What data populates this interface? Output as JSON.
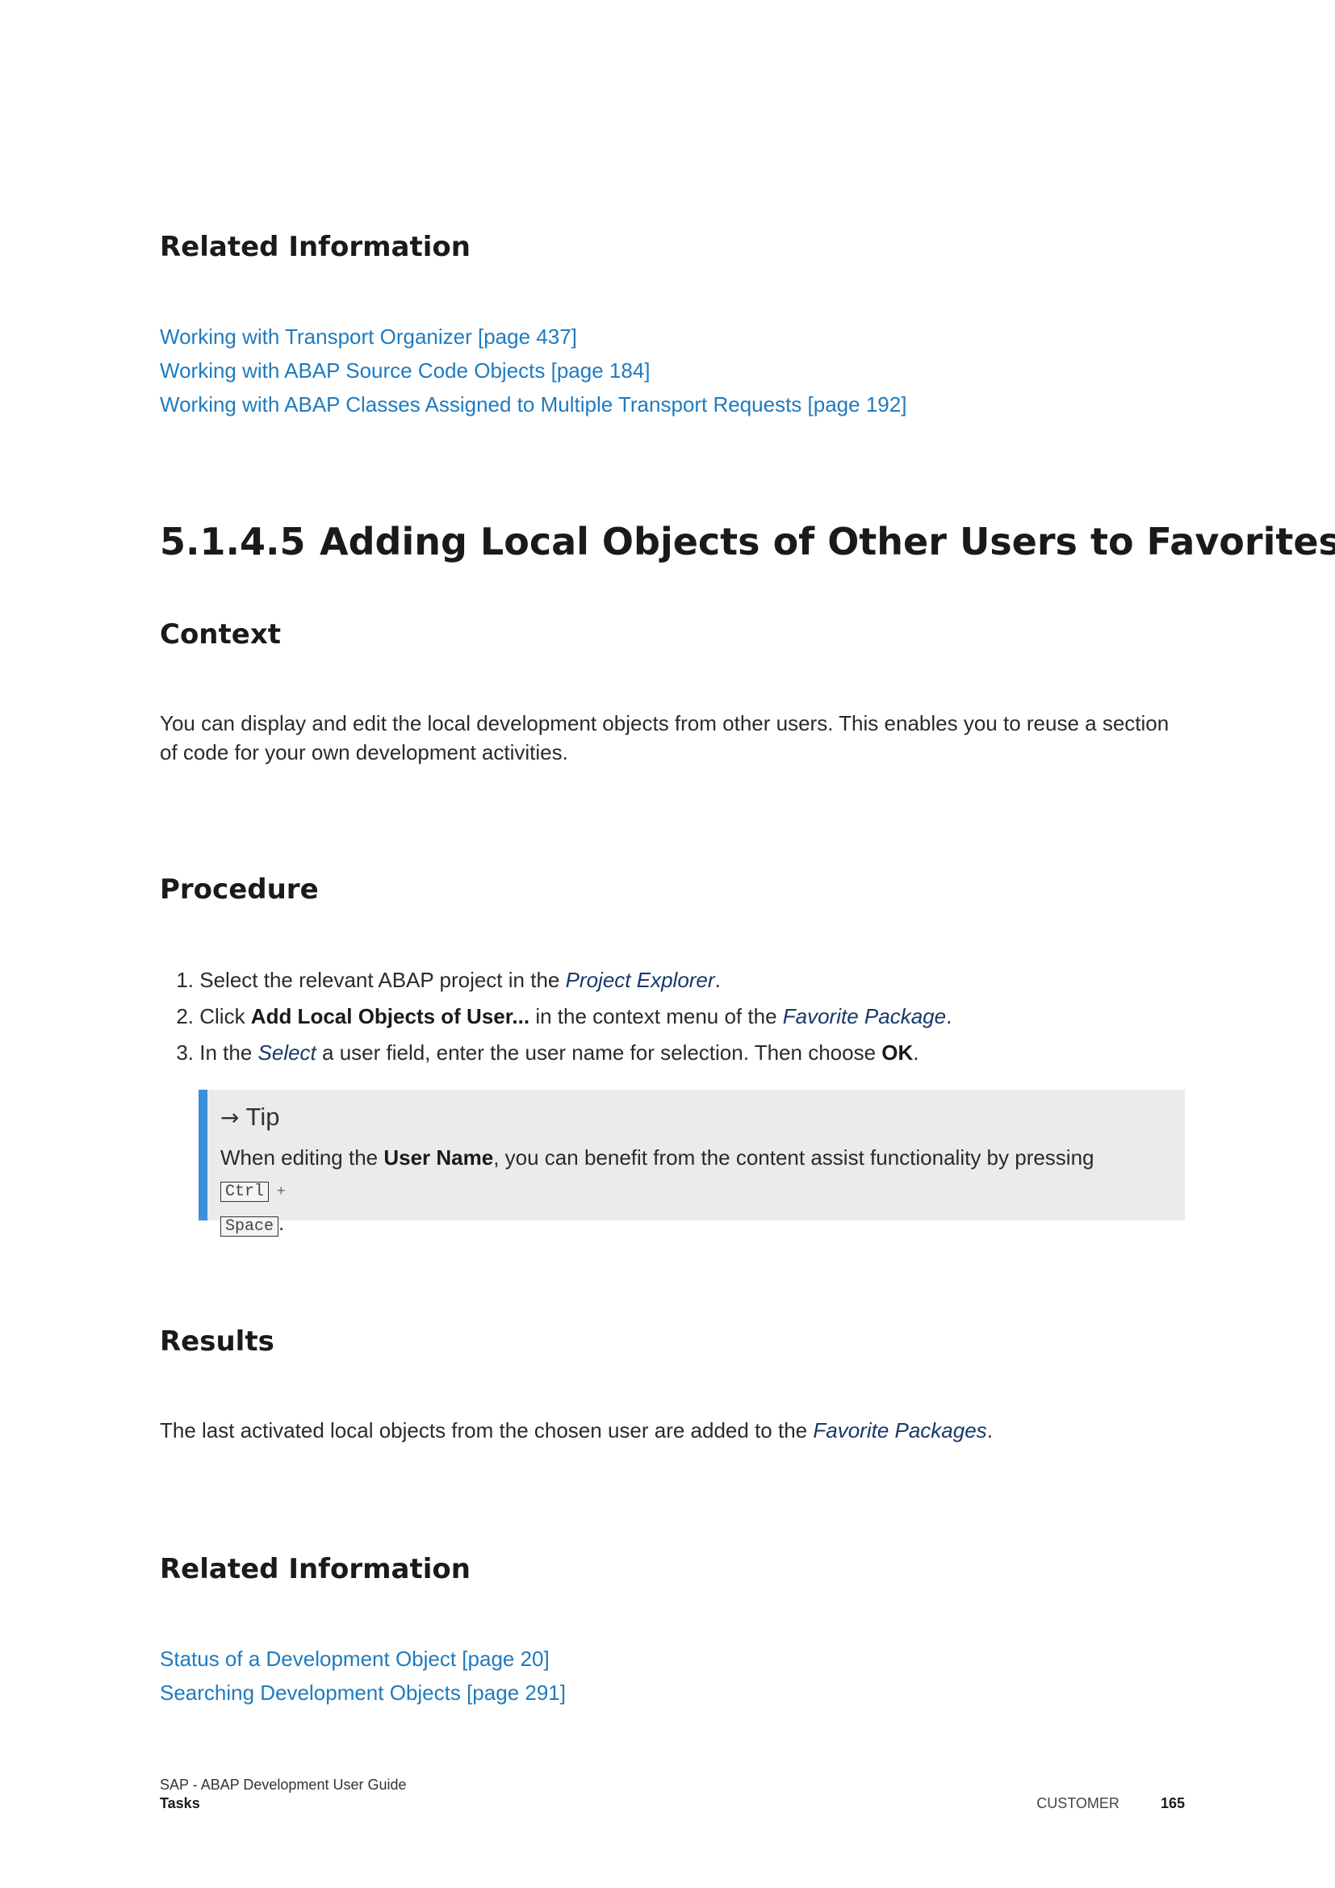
{
  "related1": {
    "heading": "Related Information",
    "links": [
      "Working with Transport Organizer [page 437]",
      "Working with ABAP Source Code Objects [page 184]",
      "Working with ABAP Classes Assigned to Multiple Transport Requests [page 192]"
    ]
  },
  "section": {
    "number": "5.1.4.5",
    "title": "Adding Local Objects of Other Users to Favorites"
  },
  "context": {
    "heading": "Context",
    "text": "You can display and edit the local development objects from other users. This enables you to reuse a section of code for your own development activities."
  },
  "procedure": {
    "heading": "Procedure",
    "steps": [
      {
        "num": "1.",
        "pre": "Select the relevant ABAP project in the ",
        "ui": "Project Explorer",
        "post": "."
      },
      {
        "num": "2.",
        "pre": "Click ",
        "bold": "Add Local Objects of User...",
        "mid": " in the context menu of the ",
        "ui": "Favorite Package",
        "post": "."
      },
      {
        "num": "3.",
        "pre": "In the ",
        "ui": "Select",
        "mid": " a user field, enter the user name for selection. Then choose ",
        "bold": "OK",
        "post": "."
      }
    ],
    "tip": {
      "title": "Tip",
      "pre": "When editing the ",
      "bold": "User Name",
      "mid": ", you can benefit from the content assist functionality by pressing ",
      "key1": "Ctrl",
      "plus": "+",
      "key2": "Space",
      "post": "."
    }
  },
  "results": {
    "heading": "Results",
    "pre": "The last activated local objects from the chosen user are added to the ",
    "ui": "Favorite Packages",
    "post": "."
  },
  "related2": {
    "heading": "Related Information",
    "links": [
      "Status of a Development Object [page 20]",
      "Searching Development Objects [page 291]"
    ]
  },
  "footer": {
    "doc_title": "SAP - ABAP Development User Guide",
    "chapter": "Tasks",
    "classification": "CUSTOMER",
    "page_number": "165"
  },
  "colors": {
    "link": "#1f7bbf",
    "ui_term": "#15386b",
    "tip_bar": "#3c8fd8",
    "tip_bg": "#ebebeb"
  }
}
